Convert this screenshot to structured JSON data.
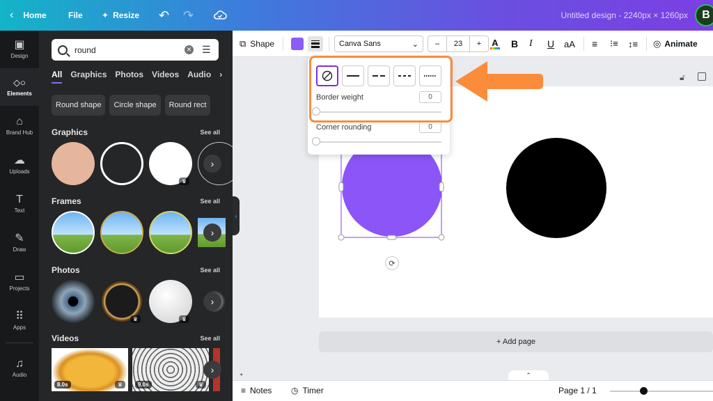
{
  "topbar": {
    "home": "Home",
    "file": "File",
    "resize": "Resize",
    "title": "Untitled design - 2240px × 1260px",
    "avatar": "B"
  },
  "rail": [
    {
      "label": "Design",
      "icon": "design-icon",
      "glyph": "▣"
    },
    {
      "label": "Elements",
      "icon": "elements-icon",
      "glyph": "◇○"
    },
    {
      "label": "Brand Hub",
      "icon": "brand-hub-icon",
      "glyph": "⌂"
    },
    {
      "label": "Uploads",
      "icon": "uploads-icon",
      "glyph": "☁"
    },
    {
      "label": "Text",
      "icon": "text-icon",
      "glyph": "T"
    },
    {
      "label": "Draw",
      "icon": "draw-icon",
      "glyph": "✎"
    },
    {
      "label": "Projects",
      "icon": "projects-icon",
      "glyph": "▭"
    },
    {
      "label": "Apps",
      "icon": "apps-icon",
      "glyph": "⠿"
    },
    {
      "label": "Audio",
      "icon": "audio-icon",
      "glyph": "♫"
    }
  ],
  "panel": {
    "search_value": "round",
    "tabs": [
      "All",
      "Graphics",
      "Photos",
      "Videos",
      "Audio"
    ],
    "chips": [
      "Round shape",
      "Circle shape",
      "Round rect"
    ],
    "sections": {
      "graphics": "Graphics",
      "frames": "Frames",
      "photos": "Photos",
      "videos": "Videos"
    },
    "see_all": "See all",
    "video_durations": [
      "8.0s",
      "9.0s"
    ]
  },
  "toolbar": {
    "shape": "Shape",
    "shape_color": "#8b5cf6",
    "font": "Canva Sans",
    "font_size": "23",
    "minus": "–",
    "plus": "+",
    "animate": "Animate"
  },
  "popover": {
    "border_weight_label": "Border weight",
    "border_weight_value": "0",
    "corner_rounding_label": "Corner rounding",
    "corner_rounding_value": "0"
  },
  "canvas": {
    "add_page": "+ Add page",
    "circle_purple": "#8b55f7",
    "circle_black": "#000000"
  },
  "bottom": {
    "notes": "Notes",
    "timer": "Timer",
    "page": "Page 1 / 1"
  },
  "colors": {
    "accent": "#7d2ae8",
    "highlight": "#fb8c3c"
  }
}
